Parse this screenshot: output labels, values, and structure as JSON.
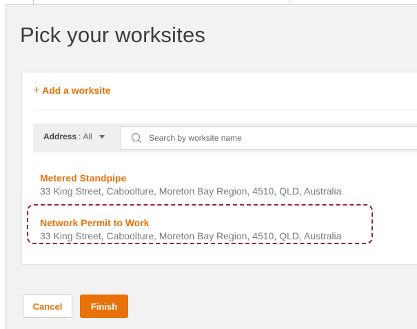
{
  "page": {
    "title": "Pick your worksites"
  },
  "add_worksite": {
    "label": "Add a worksite"
  },
  "filter": {
    "address_label": "Address",
    "address_separator": ":",
    "address_value": "All",
    "search_placeholder": "Search by worksite name"
  },
  "worksites": [
    {
      "name": "Metered Standpipe",
      "address": "33 King Street, Caboolture, Moreton Bay Region, 4510, QLD, Australia"
    },
    {
      "name": "Network Permit to Work",
      "address": "33 King Street, Caboolture, Moreton Bay Region, 4510, QLD, Australia",
      "highlighted": true
    }
  ],
  "actions": {
    "cancel_label": "Cancel",
    "finish_label": "Finish"
  },
  "colors": {
    "accent": "#e8710a",
    "highlight_border": "#a31f2b",
    "background": "#f2f2f2"
  },
  "icons": [
    "plus-icon",
    "chevron-down-icon",
    "search-icon"
  ]
}
